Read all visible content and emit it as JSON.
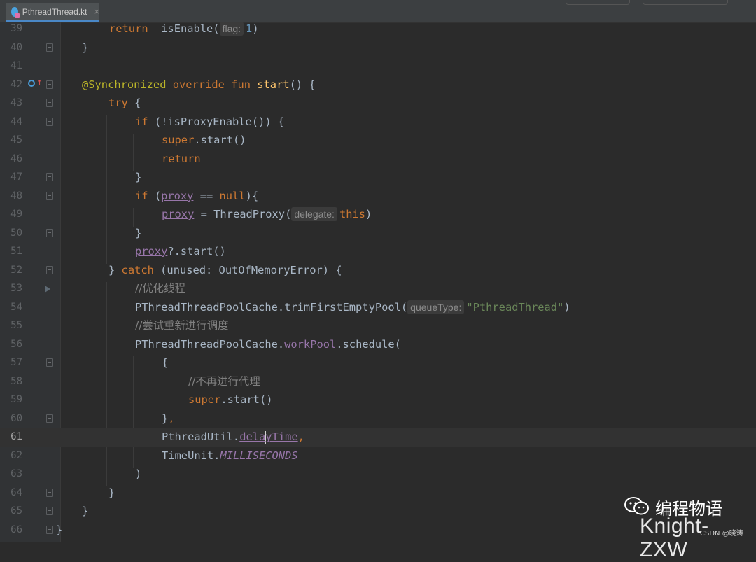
{
  "tab": {
    "label": "PthreadThread.kt",
    "close": "×"
  },
  "lines": [
    {
      "n": "39"
    },
    {
      "n": "40"
    },
    {
      "n": "41"
    },
    {
      "n": "42"
    },
    {
      "n": "43"
    },
    {
      "n": "44"
    },
    {
      "n": "45"
    },
    {
      "n": "46"
    },
    {
      "n": "47"
    },
    {
      "n": "48"
    },
    {
      "n": "49"
    },
    {
      "n": "50"
    },
    {
      "n": "51"
    },
    {
      "n": "52"
    },
    {
      "n": "53"
    },
    {
      "n": "54"
    },
    {
      "n": "55"
    },
    {
      "n": "56"
    },
    {
      "n": "57"
    },
    {
      "n": "58"
    },
    {
      "n": "59"
    },
    {
      "n": "60"
    },
    {
      "n": "61"
    },
    {
      "n": "62"
    },
    {
      "n": "63"
    },
    {
      "n": "64"
    },
    {
      "n": "65"
    },
    {
      "n": "66"
    }
  ],
  "current_line": "61",
  "code": {
    "l39": {
      "kw_return": "return",
      "call": "isEnable(",
      "hint": "flag:",
      "num": "1",
      "close": ")"
    },
    "l40": {
      "brace": "}"
    },
    "l42": {
      "ann": "@Synchronized",
      "kw_override": "override",
      "kw_fun": "fun",
      "fn": "start",
      "rest": "() {"
    },
    "l43": {
      "kw_try": "try",
      "rest": " {"
    },
    "l44": {
      "kw_if": "if",
      "rest": " (!isProxyEnable()) {"
    },
    "l45": {
      "kw_super": "super",
      "rest": ".start()"
    },
    "l46": {
      "kw_return": "return"
    },
    "l47": {
      "brace": "}"
    },
    "l48": {
      "kw_if": "if",
      "open": " (",
      "prop": "proxy",
      "mid": " == ",
      "kw_null": "null",
      "rest": "){"
    },
    "l49": {
      "prop": "proxy",
      "mid": " = ThreadProxy(",
      "hint": "delegate:",
      "kw_this": "this",
      "close": ")"
    },
    "l50": {
      "brace": "}"
    },
    "l51": {
      "prop": "proxy",
      "rest": "?.start()"
    },
    "l52": {
      "open": "} ",
      "kw_catch": "catch",
      "rest": " (unused: OutOfMemoryError) {"
    },
    "l53": {
      "comment": "//优化线程"
    },
    "l54": {
      "call": "PThreadThreadPoolCache.trimFirstEmptyPool(",
      "hint": "queueType:",
      "str": "\"PthreadThread\"",
      "close": ")"
    },
    "l55": {
      "comment": "//尝试重新进行调度"
    },
    "l56": {
      "pre": "PThreadThreadPoolCache.",
      "propp": "workPool",
      "rest": ".schedule("
    },
    "l57": {
      "brace": "{"
    },
    "l58": {
      "comment": "//不再进行代理"
    },
    "l59": {
      "kw_super": "super",
      "rest": ".start()"
    },
    "l60": {
      "brace": "}",
      "comma": ","
    },
    "l61": {
      "pre": "PthreadUtil.",
      "prop_a": "dela",
      "prop_b": "yTime",
      "comma": ","
    },
    "l62": {
      "pre": "TimeUnit.",
      "ital": "MILLISECONDS"
    },
    "l63": {
      "brace": ")"
    },
    "l64": {
      "brace": "}"
    },
    "l65": {
      "brace": "}"
    },
    "l66": {
      "brace": "}"
    }
  },
  "watermark": {
    "title": "编程物语",
    "name": "Knight-ZXW",
    "csdn": "CSDN @晓涛"
  },
  "colors": {
    "keyword": "#cc7832",
    "function": "#ffc66d",
    "annotation": "#bbb529",
    "number": "#6897bb",
    "string": "#6a8759",
    "comment": "#808080",
    "property": "#9876aa",
    "text": "#a9b7c6",
    "background": "#2b2b2b"
  }
}
